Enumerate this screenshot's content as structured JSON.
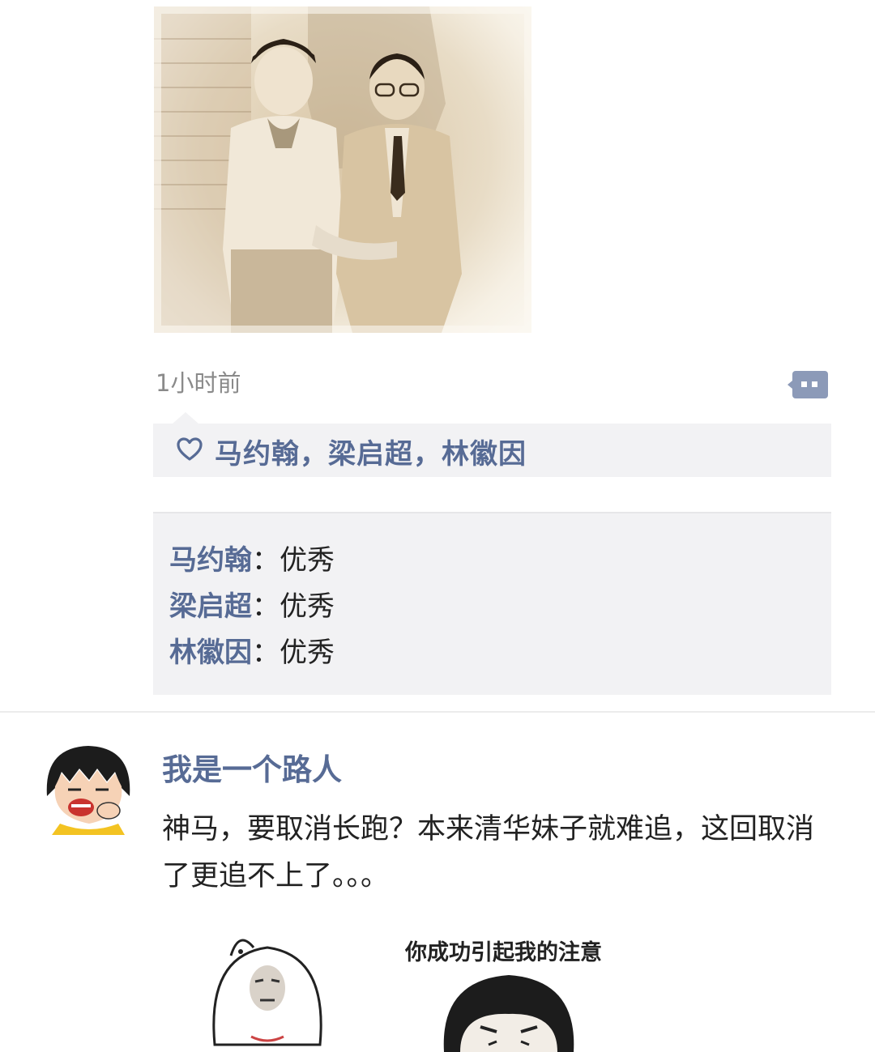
{
  "post1": {
    "timestamp": "1小时前",
    "likes": "马约翰，梁启超，林徽因",
    "comments": [
      {
        "author": "马约翰",
        "separator": "：",
        "text": "优秀"
      },
      {
        "author": "梁启超",
        "separator": "：",
        "text": "优秀"
      },
      {
        "author": "林徽因",
        "separator": "：",
        "text": "优秀"
      }
    ]
  },
  "post2": {
    "author": "我是一个路人",
    "text": "神马，要取消长跑？本来清华妹子就难追，这回取消了更追不上了。。。",
    "meme_caption": "你成功引起我的注意"
  },
  "colors": {
    "link": "#576b95",
    "box_bg": "#f2f2f4",
    "timestamp": "#8a8a8a"
  }
}
